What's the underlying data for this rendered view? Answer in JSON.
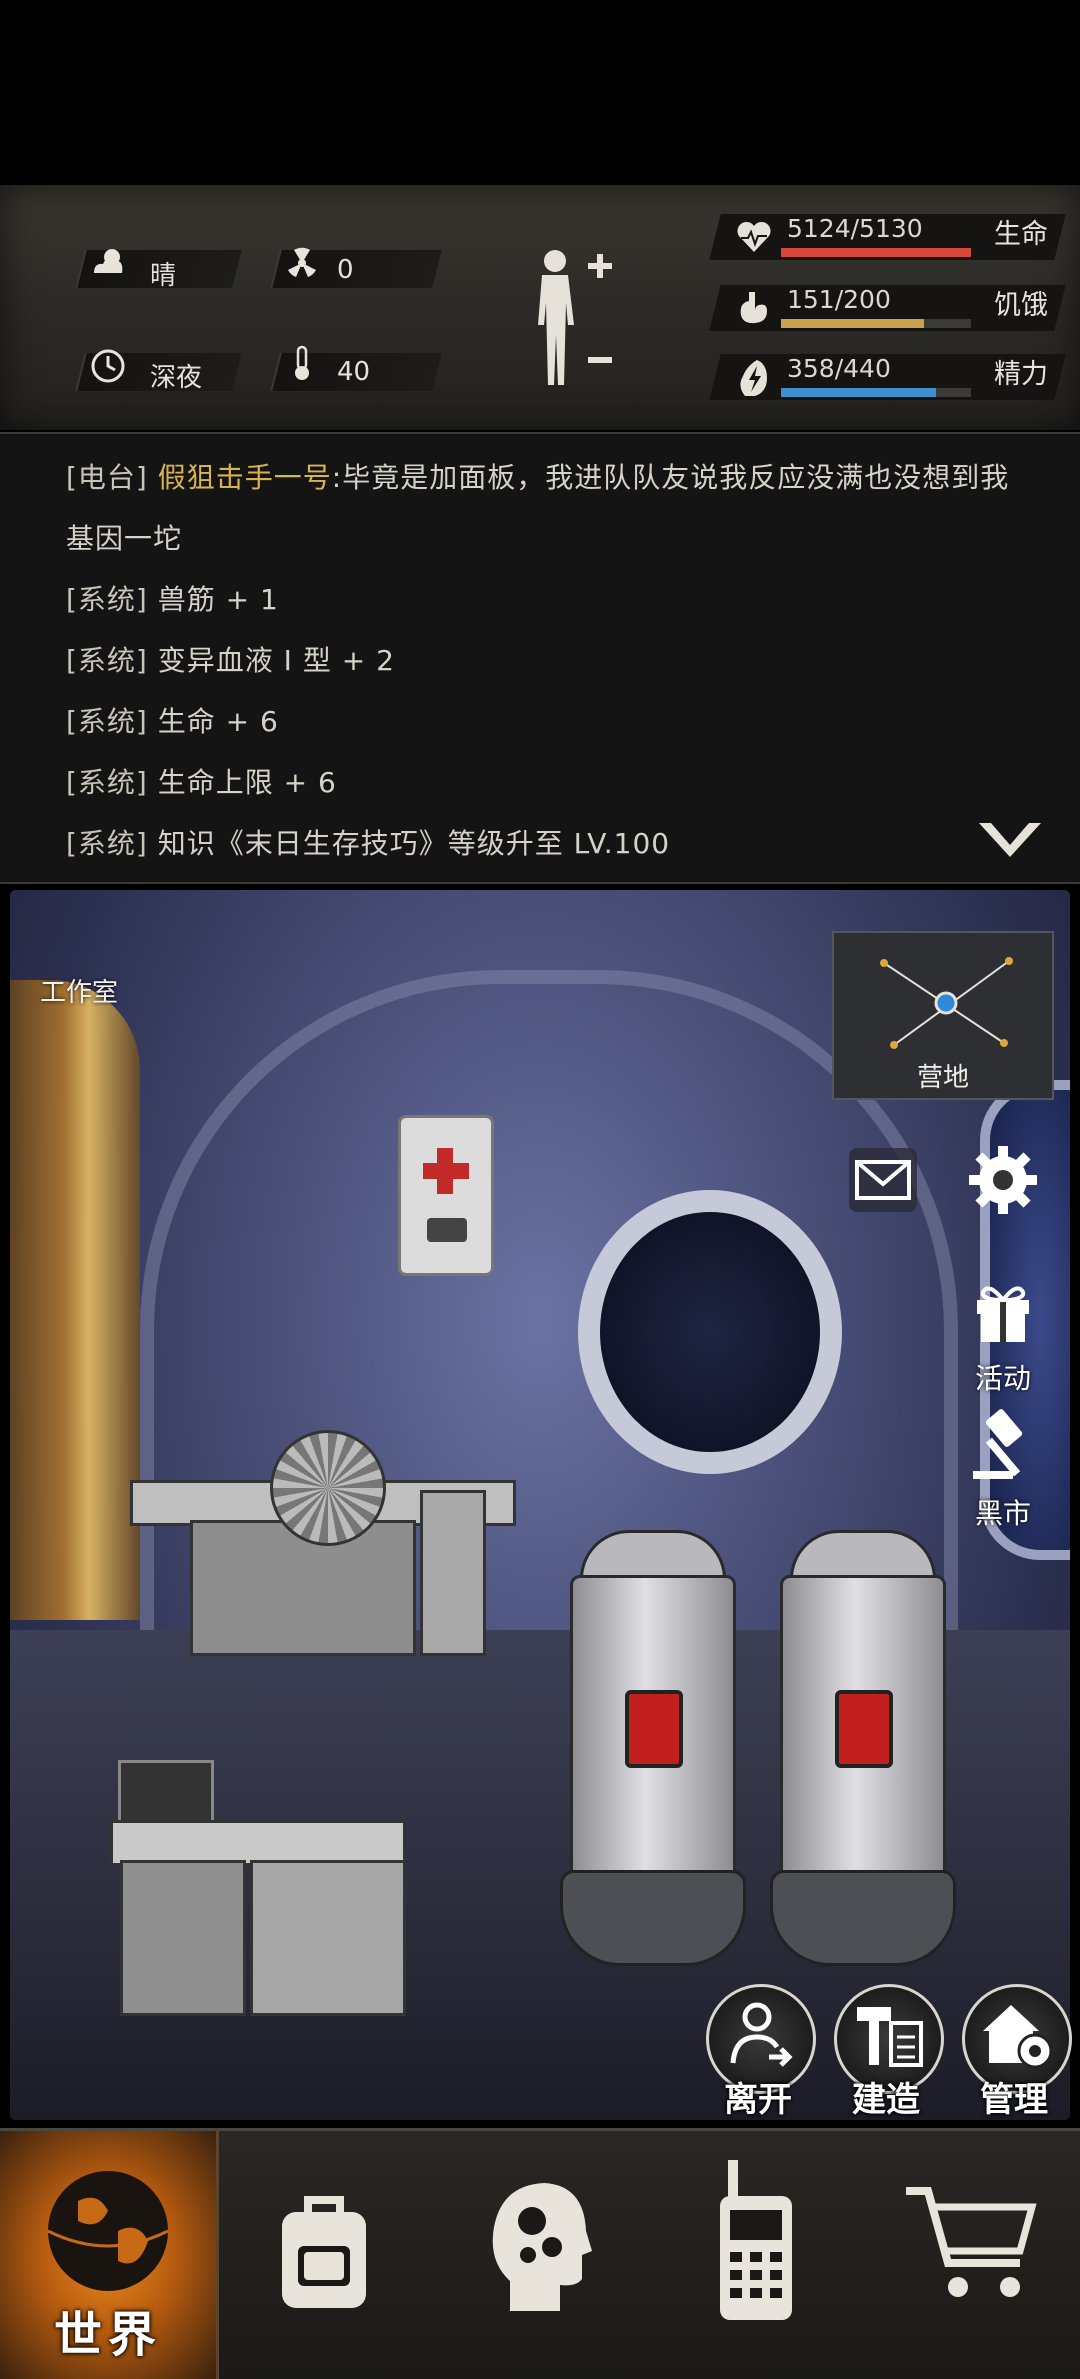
{
  "status": {
    "weather": {
      "icon": "cloud-sun-icon",
      "label": "晴"
    },
    "radiation": {
      "icon": "radiation-icon",
      "value": "0"
    },
    "time": {
      "icon": "clock-icon",
      "label": "深夜"
    },
    "temperature": {
      "icon": "thermometer-icon",
      "value": "40"
    },
    "stats": [
      {
        "key": "health",
        "icon": "heart-icon",
        "value_text": "5124/5130",
        "label": "生命",
        "fraction": 0.999,
        "color": "#d9473a"
      },
      {
        "key": "hunger",
        "icon": "stomach-icon",
        "value_text": "151/200",
        "label": "饥饿",
        "fraction": 0.755,
        "color": "#c9a14a"
      },
      {
        "key": "energy",
        "icon": "energy-icon",
        "value_text": "358/440",
        "label": "精力",
        "fraction": 0.814,
        "color": "#3d8fd1"
      }
    ]
  },
  "chat": {
    "lines": [
      {
        "tag": "[电台]",
        "speaker": "假狙击手一号",
        "text": ":毕竟是加面板，我进队队友说我反应没满也没想到我"
      },
      {
        "tag": "",
        "speaker": "",
        "text": "基因一坨"
      },
      {
        "tag": "[系统]",
        "speaker": "",
        "text": "兽筋 + 1"
      },
      {
        "tag": "[系统]",
        "speaker": "",
        "text": "变异血液 I 型 + 2"
      },
      {
        "tag": "[系统]",
        "speaker": "",
        "text": "生命 + 6"
      },
      {
        "tag": "[系统]",
        "speaker": "",
        "text": "生命上限 + 6"
      },
      {
        "tag": "[系统]",
        "speaker": "",
        "text": "知识《末日生存技巧》等级升至 LV.100"
      }
    ],
    "collapse_icon": "chevron-down-icon"
  },
  "scene": {
    "room_label": "工作室",
    "minimap_label": "营地",
    "side_buttons": [
      {
        "key": "mail",
        "icon": "envelope-icon",
        "label": ""
      },
      {
        "key": "settings",
        "icon": "gear-icon",
        "label": ""
      },
      {
        "key": "events",
        "icon": "gift-icon",
        "label": "活动"
      },
      {
        "key": "black_market",
        "icon": "gavel-icon",
        "label": "黑市"
      }
    ],
    "actions": [
      {
        "key": "leave",
        "icon": "person-exit-icon",
        "label": "离开"
      },
      {
        "key": "build",
        "icon": "hammer-icon",
        "label": "建造"
      },
      {
        "key": "manage",
        "icon": "house-gear-icon",
        "label": "管理"
      }
    ]
  },
  "nav": {
    "items": [
      {
        "key": "world",
        "icon": "globe-icon",
        "label": "世界",
        "active": true
      },
      {
        "key": "backpack",
        "icon": "backpack-icon",
        "label": ""
      },
      {
        "key": "skills",
        "icon": "head-gears-icon",
        "label": ""
      },
      {
        "key": "radio",
        "icon": "walkie-talkie-icon",
        "label": ""
      },
      {
        "key": "shop",
        "icon": "cart-icon",
        "label": ""
      }
    ]
  }
}
